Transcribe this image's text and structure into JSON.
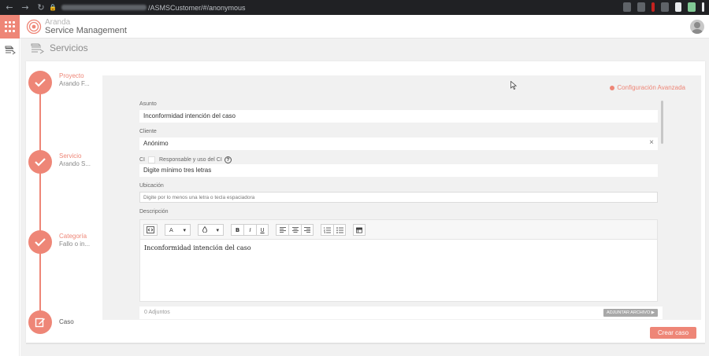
{
  "browser": {
    "url_path": "/ASMSCustomer/#/anonymous",
    "nav_back": "←",
    "nav_forward": "→",
    "nav_reload": "↻"
  },
  "app": {
    "brand_top": "Aranda",
    "brand_bottom": "Service Management"
  },
  "page": {
    "title": "Servicios"
  },
  "steps": [
    {
      "title": "Proyecto",
      "value": "Arando F..."
    },
    {
      "title": "Servicio",
      "value": "Arando S..."
    },
    {
      "title": "Categoría",
      "value": "Fallo o in..."
    },
    {
      "title": "Caso",
      "value": ""
    }
  ],
  "form": {
    "advanced_config": "Configuración Avanzada",
    "subject_label": "Asunto",
    "subject_value": "Inconformidad intención del caso",
    "client_label": "Cliente",
    "client_value": "Anónimo",
    "client_clear": "×",
    "ci_label": "CI",
    "ci_responsible": "Responsable y uso del CI",
    "ci_placeholder": "Digite mínimo tres letras",
    "location_label": "Ubicación",
    "location_placeholder": "Digite por lo menos una letra o tecla espaciadora",
    "description_label": "Descripción",
    "description_text": "Inconformidad intención del caso",
    "toolbar": {
      "font_label": "A",
      "bold": "B",
      "italic": "I",
      "underline": "U",
      "dropdown_arrow": "▾"
    },
    "attachments_label": "0 Adjuntos",
    "attach_button": "ADJUNTAR ARCHIVO ▶"
  },
  "actions": {
    "create_case": "Crear caso"
  },
  "colors": {
    "accent": "#ee8677",
    "chrome": "#202124",
    "panel": "#f1f1f1"
  }
}
